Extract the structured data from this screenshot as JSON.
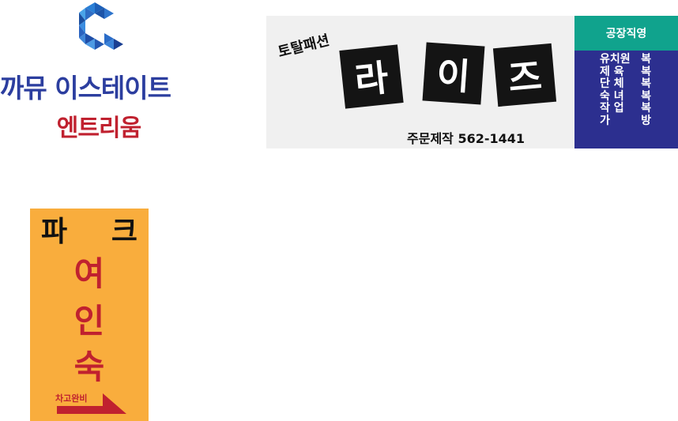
{
  "estate": {
    "name": "까뮤 이스테이트",
    "sub": "엔트리움",
    "logo_icon": "hexagon-c-logo-icon",
    "colors": {
      "primary": "#2c3e9f",
      "accent": "#c0212f"
    }
  },
  "banner": {
    "tag": "토탈패션",
    "tiles": [
      "라",
      "이",
      "즈"
    ],
    "phone": "주문제작  562-1441",
    "head": "공장직영",
    "rows": [
      [
        "유치원",
        "복"
      ],
      [
        "제 육",
        "복"
      ],
      [
        "단 체",
        "복"
      ],
      [
        "숙 녀",
        "복"
      ],
      [
        "작 업",
        "복"
      ],
      [
        "가",
        "방"
      ]
    ],
    "colors": {
      "panel": "#f0f0f0",
      "tile": "#141414",
      "head": "#10a38d",
      "list": "#2c2f8f"
    }
  },
  "motel": {
    "top": [
      "파",
      "크"
    ],
    "chars": [
      "여",
      "인",
      "숙"
    ],
    "parking": "차고완비",
    "arrow_icon": "arrow-right-icon",
    "colors": {
      "background": "#f9ad3d",
      "accent": "#c0212f"
    }
  }
}
